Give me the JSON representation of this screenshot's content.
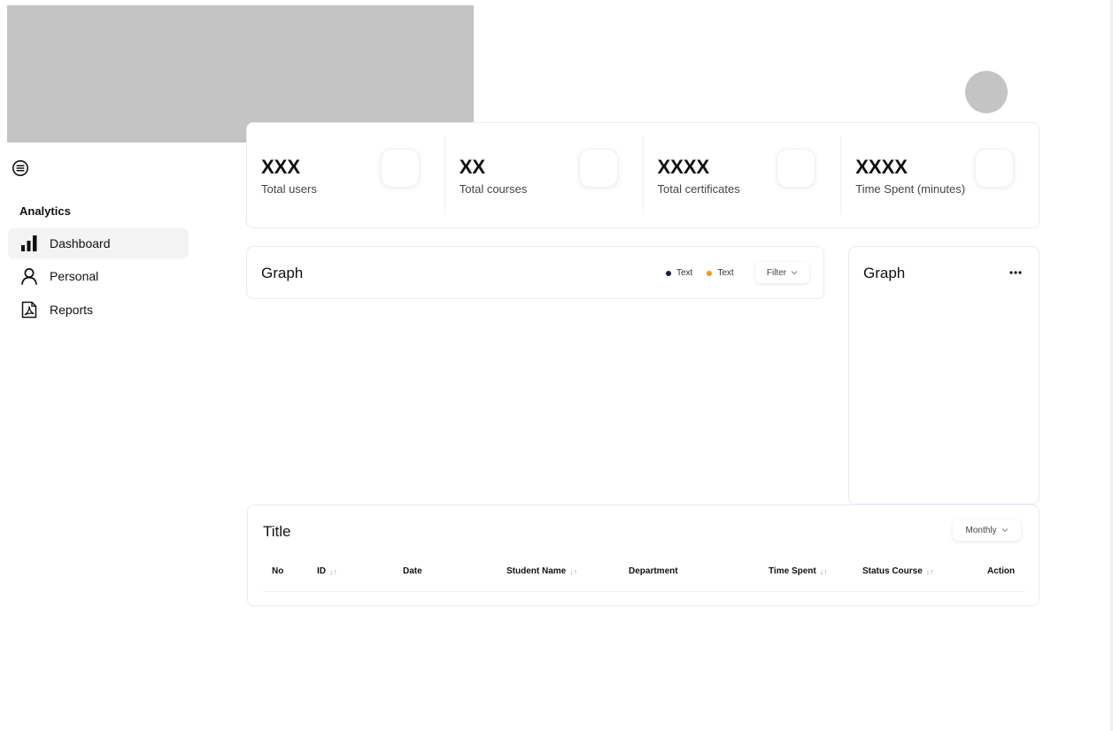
{
  "sidebar": {
    "menu_icon": "menu-circle-icon",
    "section_label": "Analytics",
    "items": [
      {
        "label": "Dashboard",
        "icon": "bar-chart-icon",
        "active": true
      },
      {
        "label": "Personal",
        "icon": "user-icon",
        "active": false
      },
      {
        "label": "Reports",
        "icon": "pdf-file-icon",
        "active": false
      }
    ]
  },
  "stats": [
    {
      "value": "XXX",
      "label": "Total users"
    },
    {
      "value": "XX",
      "label": "Total courses"
    },
    {
      "value": "XXXX",
      "label": "Total certificates"
    },
    {
      "value": "XXXX",
      "label": "Time Spent (minutes)"
    }
  ],
  "graph_main": {
    "title": "Graph",
    "legend": [
      {
        "label": "Text",
        "color": "#1b1a4e"
      },
      {
        "label": "Text",
        "color": "#f7941d"
      }
    ],
    "filter_label": "Filter"
  },
  "graph_side": {
    "title": "Graph",
    "more_icon": "more-horizontal-icon"
  },
  "table": {
    "title": "Title",
    "period_label": "Monthly",
    "columns": [
      {
        "label": "No",
        "sortable": false
      },
      {
        "label": "ID",
        "sortable": true
      },
      {
        "label": "Date",
        "sortable": false
      },
      {
        "label": "Student Name",
        "sortable": true
      },
      {
        "label": "Department",
        "sortable": false
      },
      {
        "label": "Time Spent",
        "sortable": true
      },
      {
        "label": "Status Course",
        "sortable": true
      },
      {
        "label": "Action",
        "sortable": false
      }
    ]
  },
  "colors": {
    "placeholder_gray": "#c4c4c4",
    "card_border": "#e8ebf3",
    "active_nav_bg": "#f3f3f4",
    "legend_dark": "#1b1a4e",
    "legend_orange": "#f7941d"
  }
}
